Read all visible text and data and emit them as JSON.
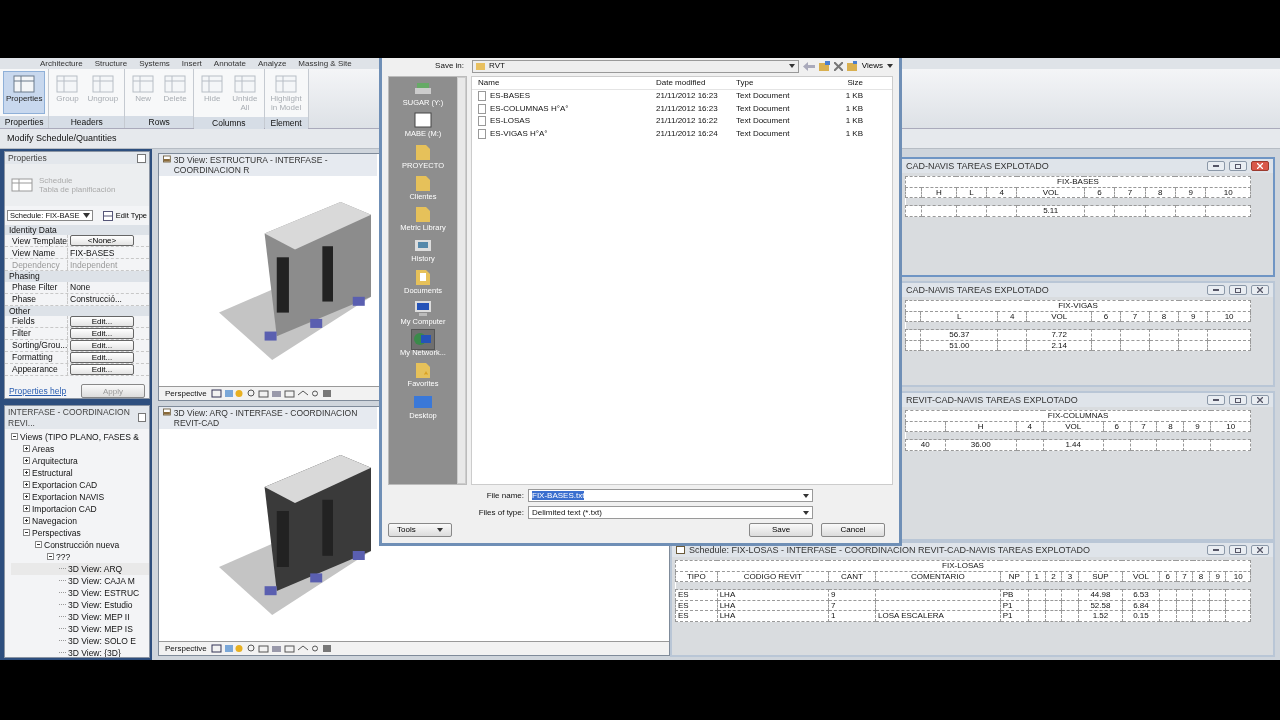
{
  "ribbon": {
    "tabs": [
      "Architecture",
      "Structure",
      "Systems",
      "Insert",
      "Annotate",
      "Analyze",
      "Massing & Site"
    ],
    "panels": [
      {
        "label": "Properties",
        "buttons": [
          {
            "lines": [
              "Properties"
            ],
            "disabled": false,
            "active": true
          }
        ]
      },
      {
        "label": "Headers",
        "buttons": [
          {
            "lines": [
              "Group"
            ],
            "disabled": true,
            "active": false
          },
          {
            "lines": [
              "Ungroup"
            ],
            "disabled": true,
            "active": false
          }
        ]
      },
      {
        "label": "Rows",
        "buttons": [
          {
            "lines": [
              "New"
            ],
            "disabled": true,
            "active": false
          },
          {
            "lines": [
              "Delete"
            ],
            "disabled": true,
            "active": false
          }
        ]
      },
      {
        "label": "Columns",
        "buttons": [
          {
            "lines": [
              "Hide"
            ],
            "disabled": true,
            "active": false
          },
          {
            "lines": [
              "Unhide",
              "All"
            ],
            "disabled": true,
            "active": false
          }
        ]
      },
      {
        "label": "Element",
        "buttons": [
          {
            "lines": [
              "Highlight",
              "in Model"
            ],
            "disabled": true,
            "active": false
          }
        ]
      }
    ]
  },
  "options_bar": {
    "label": "Modify Schedule/Quantities"
  },
  "properties": {
    "title": "Properties",
    "type_name": "Schedule",
    "type_subname": "Tabla de planificación",
    "selector": "Schedule: FIX-BASE",
    "edit_type": "Edit Type",
    "groups": [
      {
        "name": "Identity Data",
        "rows": [
          {
            "label": "View Template",
            "value": "<None>",
            "kind": "button",
            "disabled": false
          },
          {
            "label": "View Name",
            "value": "FIX-BASES",
            "kind": "text",
            "disabled": false
          },
          {
            "label": "Dependency",
            "value": "Independent",
            "kind": "text",
            "disabled": true
          }
        ]
      },
      {
        "name": "Phasing",
        "rows": [
          {
            "label": "Phase Filter",
            "value": "None",
            "kind": "text",
            "disabled": false
          },
          {
            "label": "Phase",
            "value": "Construcció...",
            "kind": "text",
            "disabled": false
          }
        ]
      },
      {
        "name": "Other",
        "rows": [
          {
            "label": "Fields",
            "value": "Edit...",
            "kind": "button",
            "disabled": false
          },
          {
            "label": "Filter",
            "value": "Edit...",
            "kind": "button",
            "disabled": false
          },
          {
            "label": "Sorting/Grou...",
            "value": "Edit...",
            "kind": "button",
            "disabled": false
          },
          {
            "label": "Formatting",
            "value": "Edit...",
            "kind": "button",
            "disabled": false
          },
          {
            "label": "Appearance",
            "value": "Edit...",
            "kind": "button",
            "disabled": false
          }
        ]
      }
    ],
    "help_link": "Properties help",
    "apply": {
      "label": "Apply",
      "disabled": true
    }
  },
  "project_browser": {
    "title": "INTERFASE - COORDINACION REVI...",
    "tree": [
      {
        "label": "Views (TIPO PLANO, FASES &",
        "expanded": true,
        "children": [
          {
            "label": "Areas",
            "expanded": false
          },
          {
            "label": "Arquitectura",
            "expanded": false
          },
          {
            "label": "Estructural",
            "expanded": false
          },
          {
            "label": "Exportacion CAD",
            "expanded": false
          },
          {
            "label": "Exportacion NAVIS",
            "expanded": false
          },
          {
            "label": "Importacion CAD",
            "expanded": false
          },
          {
            "label": "Navegacion",
            "expanded": false
          },
          {
            "label": "Perspectivas",
            "expanded": true,
            "children": [
              {
                "label": "Construcción nueva",
                "expanded": true,
                "children": [
                  {
                    "label": "???",
                    "expanded": true,
                    "children": [
                      {
                        "label": "3D View: ARQ",
                        "selected": true
                      },
                      {
                        "label": "3D View: CAJA M",
                        "selected": false
                      },
                      {
                        "label": "3D View: ESTRUC",
                        "selected": false
                      },
                      {
                        "label": "3D View: Estudio",
                        "selected": false
                      },
                      {
                        "label": "3D View: MEP II",
                        "selected": false
                      },
                      {
                        "label": "3D View: MEP IS",
                        "selected": false
                      },
                      {
                        "label": "3D View: SOLO E",
                        "selected": false
                      },
                      {
                        "label": "3D View: {3D}",
                        "selected": false
                      }
                    ]
                  }
                ]
              }
            ]
          }
        ]
      }
    ]
  },
  "views": [
    {
      "title": "3D View: ESTRUCTURA - INTERFASE - COORDINACION R",
      "mode": "Perspective"
    },
    {
      "title": "3D View: ARQ - INTERFASE - COORDINACION REVIT-CAD",
      "mode": "Perspective"
    }
  ],
  "schedules": [
    {
      "title": "CAD-NAVIS TAREAS EXPLOTADO",
      "heading": "FIX-BASES",
      "active": true,
      "columns": [
        null,
        "H",
        "L",
        "4",
        "VOL",
        "6",
        "7",
        "8",
        "9",
        "10"
      ],
      "rows": [
        [
          null,
          null,
          null,
          null,
          "5.11",
          null,
          null,
          null,
          null,
          null
        ]
      ]
    },
    {
      "title": "CAD-NAVIS TAREAS EXPLOTADO",
      "heading": "FIX-VIGAS",
      "active": false,
      "columns": [
        null,
        "L",
        "4",
        "VOL",
        "6",
        "7",
        "8",
        "9",
        "10"
      ],
      "rows": [
        [
          null,
          "56.37",
          null,
          "7.72",
          null,
          null,
          null,
          null,
          null
        ],
        [
          null,
          "51.00",
          null,
          "2.14",
          null,
          null,
          null,
          null,
          null
        ]
      ]
    },
    {
      "title": "REVIT-CAD-NAVIS TAREAS EXPLOTADO",
      "heading": "FIX-COLUMNAS",
      "active": false,
      "columns": [
        null,
        "H",
        "4",
        "VOL",
        "6",
        "7",
        "8",
        "9",
        "10"
      ],
      "rows": [
        [
          "40",
          "36.00",
          null,
          "1.44",
          null,
          null,
          null,
          null,
          null
        ]
      ]
    },
    {
      "title": "Schedule: FIX-LOSAS - INTERFASE - COORDINACION REVIT-CAD-NAVIS TAREAS EXPLOTADO",
      "heading": "FIX-LOSAS",
      "active": false,
      "columns": [
        "TIPO",
        "CODIGO REVIT",
        "CANT",
        "COMENTARIO",
        "NP",
        "1",
        "2",
        "3",
        "SUP",
        "VOL",
        "6",
        "7",
        "8",
        "9",
        "10"
      ],
      "rows": [
        [
          "ES",
          "LHA",
          "9",
          null,
          "PB",
          null,
          null,
          null,
          "44.98",
          "6.53",
          null,
          null,
          null,
          null,
          null
        ],
        [
          "ES",
          "LHA",
          "7",
          null,
          "P1",
          null,
          null,
          null,
          "52.58",
          "6.84",
          null,
          null,
          null,
          null,
          null
        ],
        [
          "ES",
          "LHA",
          "1",
          "LOSA ESCALERA",
          "P1",
          null,
          null,
          null,
          "1.52",
          "0.15",
          null,
          null,
          null,
          null,
          null
        ]
      ]
    }
  ],
  "dialog": {
    "save_in_label": "Save in:",
    "save_in": "RVT",
    "views_label": "Views",
    "places": [
      {
        "label": "SUGAR (Y:)",
        "kind": "drive",
        "hovered": false
      },
      {
        "label": "MABE (M:)",
        "kind": "share",
        "hovered": false
      },
      {
        "label": "PROYECTO",
        "kind": "folder",
        "hovered": false
      },
      {
        "label": "Clientes",
        "kind": "folder",
        "hovered": false
      },
      {
        "label": "Metric Library",
        "kind": "folder",
        "hovered": false
      },
      {
        "label": "History",
        "kind": "history",
        "hovered": false
      },
      {
        "label": "Documents",
        "kind": "documents",
        "hovered": false
      },
      {
        "label": "My Computer",
        "kind": "computer",
        "hovered": false
      },
      {
        "label": "My Network...",
        "kind": "network",
        "hovered": true
      },
      {
        "label": "Favorites",
        "kind": "favorites",
        "hovered": false
      },
      {
        "label": "Desktop",
        "kind": "desktop",
        "hovered": false
      }
    ],
    "columns": [
      "Name",
      "Date modified",
      "Type",
      "Size"
    ],
    "files": [
      {
        "name": "ES-BASES",
        "date": "21/11/2012 16:23",
        "type": "Text Document",
        "size": "1 KB"
      },
      {
        "name": "ES-COLUMNAS H°A°",
        "date": "21/11/2012 16:23",
        "type": "Text Document",
        "size": "1 KB"
      },
      {
        "name": "ES-LOSAS",
        "date": "21/11/2012 16:22",
        "type": "Text Document",
        "size": "1 KB"
      },
      {
        "name": "ES-VIGAS H°A°",
        "date": "21/11/2012 16:24",
        "type": "Text Document",
        "size": "1 KB"
      }
    ],
    "file_name_label": "File name:",
    "file_name": "FIX-BASES.txt",
    "file_type_label": "Files of type:",
    "file_type": "Delimited text  (*.txt)",
    "tools": "Tools",
    "save": "Save",
    "cancel": "Cancel"
  }
}
